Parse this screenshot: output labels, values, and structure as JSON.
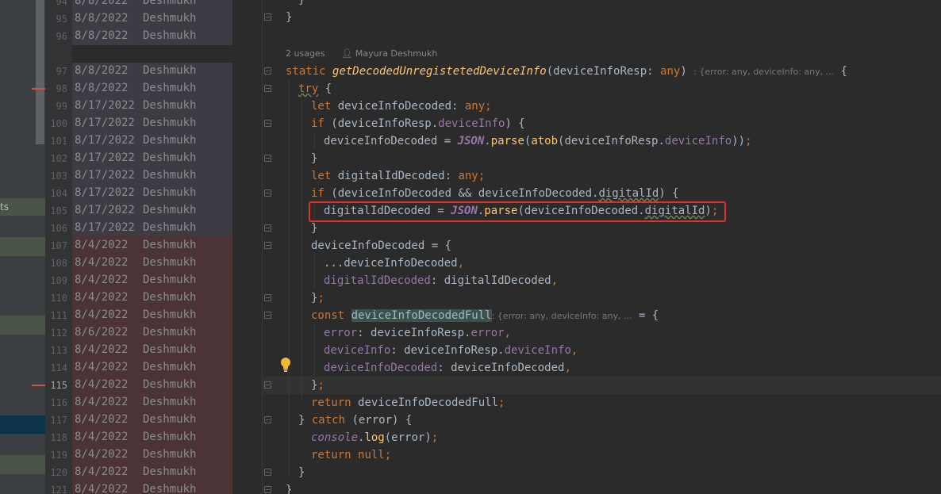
{
  "sidebar": {
    "partial_item": "ts"
  },
  "code_meta": {
    "usages": "2 usages",
    "author": "Mayura Deshmukh"
  },
  "type_hints": {
    "return_type": ": {error: any, deviceInfo: any, ...",
    "const_type": ": {error: any, deviceInfo: any, ..."
  },
  "blame": [
    {
      "line": "94",
      "date": "8/8/2022",
      "author": "Deshmukh"
    },
    {
      "line": "95",
      "date": "8/8/2022",
      "author": "Deshmukh"
    },
    {
      "line": "96",
      "date": "8/8/2022",
      "author": "Deshmukh"
    },
    {
      "line": "97",
      "date": "8/8/2022",
      "author": "Deshmukh"
    },
    {
      "line": "98",
      "date": "8/8/2022",
      "author": "Deshmukh"
    },
    {
      "line": "99",
      "date": "8/17/2022",
      "author": "Deshmukh"
    },
    {
      "line": "100",
      "date": "8/17/2022",
      "author": "Deshmukh"
    },
    {
      "line": "101",
      "date": "8/17/2022",
      "author": "Deshmukh"
    },
    {
      "line": "102",
      "date": "8/17/2022",
      "author": "Deshmukh"
    },
    {
      "line": "103",
      "date": "8/17/2022",
      "author": "Deshmukh"
    },
    {
      "line": "104",
      "date": "8/17/2022",
      "author": "Deshmukh"
    },
    {
      "line": "105",
      "date": "8/17/2022",
      "author": "Deshmukh"
    },
    {
      "line": "106",
      "date": "8/17/2022",
      "author": "Deshmukh"
    },
    {
      "line": "107",
      "date": "8/4/2022",
      "author": "Deshmukh"
    },
    {
      "line": "108",
      "date": "8/4/2022",
      "author": "Deshmukh"
    },
    {
      "line": "109",
      "date": "8/4/2022",
      "author": "Deshmukh"
    },
    {
      "line": "110",
      "date": "8/4/2022",
      "author": "Deshmukh"
    },
    {
      "line": "111",
      "date": "8/4/2022",
      "author": "Deshmukh"
    },
    {
      "line": "112",
      "date": "8/6/2022",
      "author": "Deshmukh"
    },
    {
      "line": "113",
      "date": "8/4/2022",
      "author": "Deshmukh"
    },
    {
      "line": "114",
      "date": "8/4/2022",
      "author": "Deshmukh"
    },
    {
      "line": "115",
      "date": "8/4/2022",
      "author": "Deshmukh"
    },
    {
      "line": "116",
      "date": "8/4/2022",
      "author": "Deshmukh"
    },
    {
      "line": "117",
      "date": "8/4/2022",
      "author": "Deshmukh"
    },
    {
      "line": "118",
      "date": "8/4/2022",
      "author": "Deshmukh"
    },
    {
      "line": "119",
      "date": "8/4/2022",
      "author": "Deshmukh"
    },
    {
      "line": "120",
      "date": "8/4/2022",
      "author": "Deshmukh"
    },
    {
      "line": "121",
      "date": "8/4/2022",
      "author": "Deshmukh"
    }
  ],
  "code": {
    "l94": "}",
    "l95": "}",
    "l97a": "static ",
    "l97b": "getDecodedUnregistetedDeviceInfo",
    "l97c": "(deviceInfoResp: ",
    "l97d": "any",
    "l97e": ") ",
    "l97f": " {",
    "l98a": "try",
    "l98b": " {",
    "l99a": "let ",
    "l99b": "deviceInfoDecoded: ",
    "l99c": "any",
    "l99d": ";",
    "l100a": "if ",
    "l100b": "(deviceInfoResp.",
    "l100c": "deviceInfo",
    "l100d": ") {",
    "l101a": "deviceInfoDecoded = ",
    "l101b": "JSON",
    "l101c": ".",
    "l101d": "parse",
    "l101e": "(",
    "l101f": "atob",
    "l101g": "(deviceInfoResp.",
    "l101h": "deviceInfo",
    "l101i": "))",
    "l101j": ";",
    "l102": "}",
    "l103a": "let ",
    "l103b": "digitalIdDecoded: ",
    "l103c": "any",
    "l103d": ";",
    "l104a": "if ",
    "l104b": "(deviceInfoDecoded && deviceInfoDecoded.",
    "l104c": "digitalId",
    "l104d": ") {",
    "l105a": "digitalIdDecoded = ",
    "l105b": "JSON",
    "l105c": ".",
    "l105d": "parse",
    "l105e": "(deviceInfoDecoded.",
    "l105f": "digitalId",
    "l105g": ")",
    "l105h": ";",
    "l106": "}",
    "l107a": "deviceInfoDecoded = {",
    "l108a": "...deviceInfoDecoded",
    "l108b": ",",
    "l109a": "digitalIdDecoded",
    "l109b": ": digitalIdDecoded",
    "l109c": ",",
    "l110a": "}",
    "l110b": ";",
    "l111a": "const ",
    "l111b": "deviceInfoDecodedFull",
    "l111c": " = {",
    "l112a": "error",
    "l112b": ": deviceInfoResp.",
    "l112c": "error",
    "l112d": ",",
    "l113a": "deviceInfo",
    "l113b": ": deviceInfoResp.",
    "l113c": "deviceInfo",
    "l113d": ",",
    "l114a": "deviceInfoDecoded",
    "l114b": ": deviceInfoDecoded",
    "l114c": ",",
    "l115a": "}",
    "l115b": ";",
    "l116a": "return ",
    "l116b": "deviceInfoDecodedFull",
    "l116c": ";",
    "l117a": "} ",
    "l117b": "catch ",
    "l117c": "(error) {",
    "l118a": "console",
    "l118b": ".",
    "l118c": "log",
    "l118d": "(error)",
    "l118e": ";",
    "l119a": "return ",
    "l119b": "null",
    "l119c": ";",
    "l120": "}",
    "l121": "}"
  },
  "colors": {
    "blame_purple": "#3f3b45",
    "blame_red": "#4b3336",
    "sidebar_green": "#4a5447",
    "sidebar_blue": "#0d3349",
    "highlight_box": "#e0302a"
  }
}
